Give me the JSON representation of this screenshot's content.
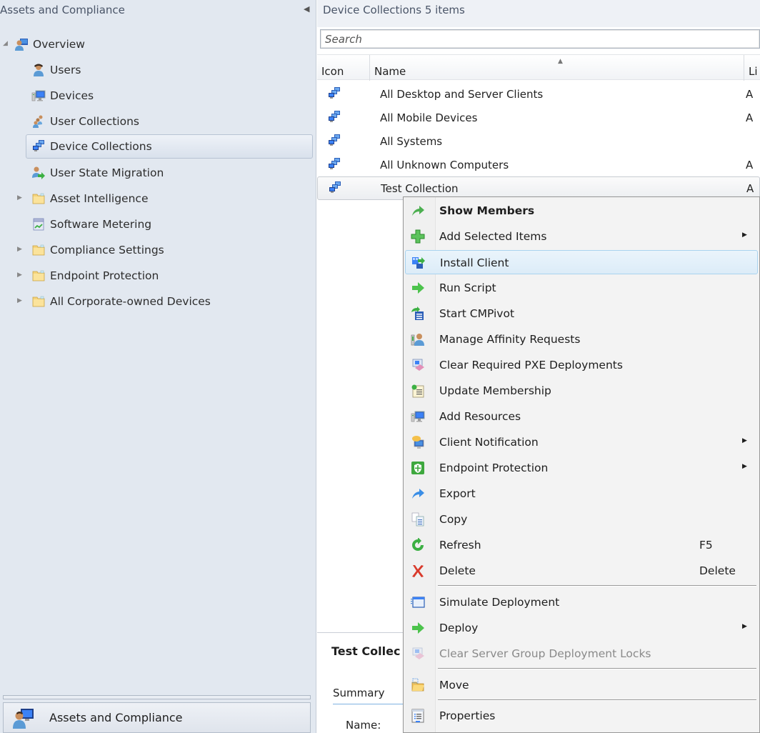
{
  "nav": {
    "title": "Assets and Compliance",
    "collapse_icon": "chevron-left-icon",
    "items": [
      {
        "label": "Overview",
        "icon": "overview-icon",
        "expander": "expanded"
      },
      {
        "label": "Users",
        "icon": "user-icon"
      },
      {
        "label": "Devices",
        "icon": "device-icon"
      },
      {
        "label": "User Collections",
        "icon": "user-collections-icon"
      },
      {
        "label": "Device Collections",
        "icon": "device-collections-icon",
        "selected": true
      },
      {
        "label": "User State Migration",
        "icon": "user-migration-icon"
      },
      {
        "label": "Asset Intelligence",
        "icon": "folder-icon",
        "expander": "collapsed"
      },
      {
        "label": "Software Metering",
        "icon": "software-metering-icon"
      },
      {
        "label": "Compliance Settings",
        "icon": "folder-icon",
        "expander": "collapsed"
      },
      {
        "label": "Endpoint Protection",
        "icon": "folder-icon",
        "expander": "collapsed"
      },
      {
        "label": "All Corporate-owned Devices",
        "icon": "folder-icon",
        "expander": "collapsed"
      }
    ],
    "workspace": {
      "label": "Assets and Compliance",
      "icon": "assets-compliance-icon"
    }
  },
  "content": {
    "header_title": "Device Collections 5 items",
    "search": {
      "placeholder": "Search",
      "value": ""
    },
    "columns": [
      "Icon",
      "Name",
      "Li"
    ],
    "rows": [
      {
        "name": "All Desktop and Server Clients",
        "limit": "A"
      },
      {
        "name": "All Mobile Devices",
        "limit": "A"
      },
      {
        "name": "All Systems",
        "limit": ""
      },
      {
        "name": "All Unknown Computers",
        "limit": "A"
      },
      {
        "name": "Test Collection",
        "limit": "A",
        "selected": true
      }
    ],
    "details": {
      "title": "Test Collec",
      "tab": "Summary",
      "name_label": "Name:"
    }
  },
  "context_menu": {
    "items": [
      {
        "label": "Show Members",
        "icon": "show-members-icon",
        "bold": true
      },
      {
        "label": "Add Selected Items",
        "icon": "add-icon",
        "submenu": true
      },
      {
        "label": "Install Client",
        "icon": "install-client-icon",
        "hover": true
      },
      {
        "label": "Run Script",
        "icon": "run-script-icon"
      },
      {
        "label": "Start CMPivot",
        "icon": "cmpivot-icon"
      },
      {
        "label": "Manage Affinity Requests",
        "icon": "affinity-icon"
      },
      {
        "label": "Clear Required PXE Deployments",
        "icon": "clear-pxe-icon"
      },
      {
        "label": "Update Membership",
        "icon": "update-membership-icon"
      },
      {
        "label": "Add Resources",
        "icon": "add-resources-icon"
      },
      {
        "label": "Client Notification",
        "icon": "client-notification-icon",
        "submenu": true
      },
      {
        "label": "Endpoint Protection",
        "icon": "endpoint-protection-icon",
        "submenu": true
      },
      {
        "label": "Export",
        "icon": "export-icon"
      },
      {
        "label": "Copy",
        "icon": "copy-icon"
      },
      {
        "label": "Refresh",
        "icon": "refresh-icon",
        "shortcut": "F5"
      },
      {
        "label": "Delete",
        "icon": "delete-icon",
        "shortcut": "Delete"
      },
      {
        "label": "Simulate Deployment",
        "icon": "simulate-deployment-icon"
      },
      {
        "label": "Deploy",
        "icon": "deploy-icon",
        "submenu": true
      },
      {
        "label": "Clear Server Group Deployment Locks",
        "icon": "clear-locks-icon",
        "disabled": true
      },
      {
        "label": "Move",
        "icon": "move-icon"
      },
      {
        "label": "Properties",
        "icon": "properties-icon"
      }
    ]
  }
}
